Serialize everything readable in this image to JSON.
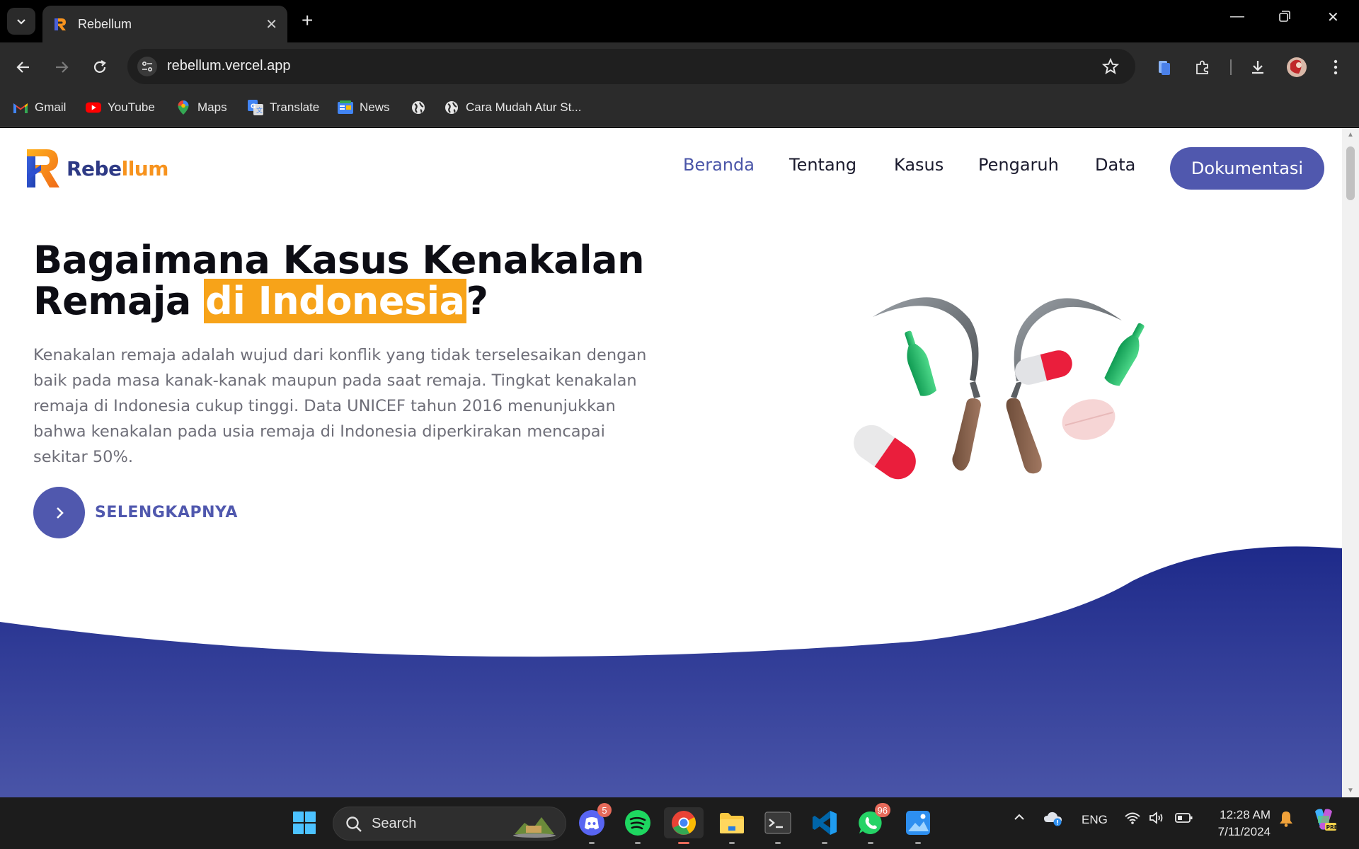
{
  "browser": {
    "tab_title": "Rebellum",
    "url": "rebellum.vercel.app",
    "bookmarks": [
      {
        "label": "Gmail",
        "icon": "gmail-icon"
      },
      {
        "label": "YouTube",
        "icon": "youtube-icon"
      },
      {
        "label": "Maps",
        "icon": "maps-icon"
      },
      {
        "label": "Translate",
        "icon": "translate-icon"
      },
      {
        "label": "News",
        "icon": "news-icon"
      },
      {
        "label": "",
        "icon": "globe-icon"
      },
      {
        "label": "Cara Mudah Atur St...",
        "icon": "globe-icon"
      }
    ]
  },
  "site": {
    "logo": {
      "prefix": "Rebe",
      "accent": "llum"
    },
    "nav": {
      "items": [
        "Beranda",
        "Tentang",
        "Kasus",
        "Pengaruh",
        "Data"
      ],
      "active": "Beranda",
      "cta": "Dokumentasi"
    },
    "hero": {
      "title_line1": "Bagaimana Kasus Kenakalan",
      "title_line2_pre": "Remaja ",
      "title_highlight": "di Indonesia",
      "title_line2_post": "?",
      "description": "Kenakalan remaja adalah wujud dari konflik yang tidak terselesaikan dengan baik pada masa kanak-kanak maupun pada saat remaja. Tingkat kenakalan remaja di Indonesia cukup tinggi. Data UNICEF tahun 2016 menunjukkan bahwa kenakalan pada usia remaja di Indonesia diperkirakan mencapai sekitar 50%.",
      "more_label": "SELENGKAPNYA"
    },
    "colors": {
      "primary": "#5058ae",
      "accent": "#f7a319",
      "wave_top": "#1e2a8a",
      "wave_bottom": "#4a55a8"
    }
  },
  "taskbar": {
    "search_placeholder": "Search",
    "discord_badge": "5",
    "whatsapp_badge": "96",
    "language": "ENG",
    "time": "12:28 AM",
    "date": "7/11/2024"
  }
}
